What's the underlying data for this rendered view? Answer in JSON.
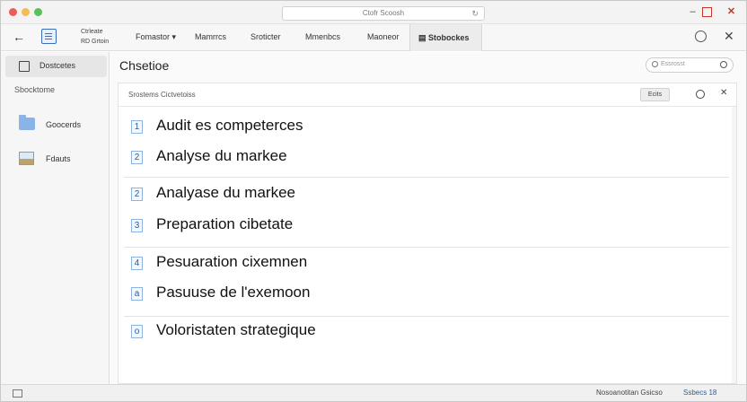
{
  "browser": {
    "url": "Ctofr Scoosh"
  },
  "toolbar": {
    "crumb_line1": "Ctrleate",
    "crumb_line2": "RD Grtoin",
    "menu": [
      {
        "label": "Fomastor",
        "has_caret": true
      },
      {
        "label": "Mamrrcs"
      },
      {
        "label": "Sroticter"
      },
      {
        "label": "Mmenbcs"
      },
      {
        "label": "Maoneor"
      }
    ],
    "active_tab": "Stobockes"
  },
  "sidebar": {
    "active_item": "Dostcetes",
    "heading": "Sbocktome",
    "items": [
      {
        "label": "Goocerds",
        "icon": "folder-icon"
      },
      {
        "label": "Fdauts",
        "icon": "image-icon"
      }
    ]
  },
  "main": {
    "title": "Chsetioe",
    "search_placeholder": "Essrosst",
    "panel_title": "Srostems Cictvetoiss",
    "edit_label": "Ecits"
  },
  "list": [
    {
      "num": "1",
      "text": "Audit es competerces"
    },
    {
      "num": "2",
      "text": "Analyse du markee"
    },
    {
      "num": "2",
      "text": "Analyase du markee"
    },
    {
      "num": "3",
      "text": "Preparation cibetate"
    },
    {
      "num": "4",
      "text": "Pesuaration cixemnen"
    },
    {
      "num": "a",
      "text": "Pasuuse de l'exemoon"
    },
    {
      "num": "o",
      "text": "Voloristaten strategique"
    }
  ],
  "statusbar": {
    "text": "Nosoanotitan Gsicso",
    "zoom": "Ssbecs 18"
  },
  "colors": {
    "accent": "#2c5d99",
    "close_red": "#c0392b"
  }
}
